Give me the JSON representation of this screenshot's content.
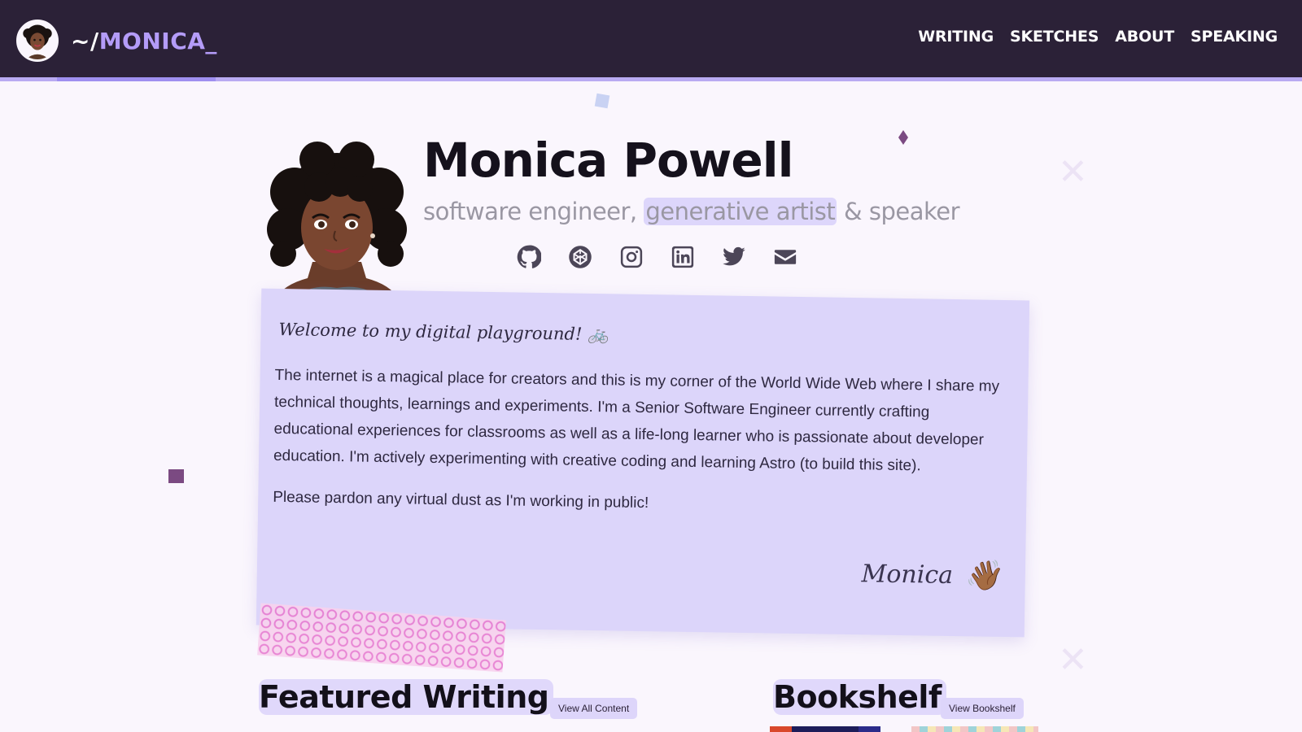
{
  "header": {
    "brand_prefix": "~/",
    "brand_name": "MONICA_",
    "nav": [
      "WRITING",
      "SKETCHES",
      "ABOUT",
      "SPEAKING"
    ]
  },
  "hero": {
    "name": "Monica Powell",
    "subtitle_start": "software engineer, ",
    "subtitle_highlight": "generative artist",
    "subtitle_end": " & speaker",
    "socials": [
      "github-icon",
      "codepen-icon",
      "instagram-icon",
      "linkedin-icon",
      "twitter-icon",
      "email-icon"
    ]
  },
  "intro": {
    "greeting": "Welcome to my digital playground! 🚲",
    "paragraph1": "The internet is a magical place for creators and this is my corner of the World Wide Web where I share my technical thoughts, learnings and experiments. I'm a Senior Software Engineer currently crafting educational experiences for classrooms as well as a life-long learner who is passionate about developer education. I'm actively experimenting with creative coding and learning Astro (to build this site).",
    "paragraph2": "Please pardon any virtual dust as I'm working in public!",
    "signature": "Monica",
    "wave": "👋🏾"
  },
  "featured": {
    "title": "Featured Writing",
    "button": "View All Content"
  },
  "bookshelf": {
    "title": "Bookshelf",
    "button": "View Bookshelf"
  },
  "colors": {
    "header_bg": "#2b2137",
    "accent": "#b49cf8",
    "card_bg": "#dcd5fa",
    "page_bg": "#faf6fd"
  }
}
